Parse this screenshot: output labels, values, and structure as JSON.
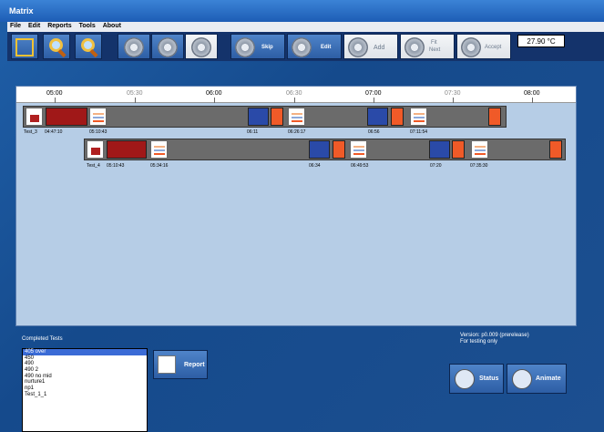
{
  "window": {
    "title": "Matrix"
  },
  "menu": [
    "File",
    "Edit",
    "Reports",
    "Tools",
    "About"
  ],
  "toolbar": {
    "skip_label": "Skip",
    "edit_label": "Edit",
    "add_label": "Add",
    "fit_label_1": "Fit",
    "fit_label_2": "Next",
    "accept_label": "Accept",
    "temperature": "27.90 °C",
    "icons": [
      "fit-view-icon",
      "zoom-out-icon",
      "zoom-in-icon",
      "gear-run-icon",
      "gear-stop-icon",
      "gear-play-icon"
    ]
  },
  "timeline": {
    "ticks": [
      {
        "label": "05:00",
        "major": true
      },
      {
        "label": "05:30",
        "major": false
      },
      {
        "label": "06:00",
        "major": true
      },
      {
        "label": "06:30",
        "major": false
      },
      {
        "label": "07:00",
        "major": true
      },
      {
        "label": "07:30",
        "major": false
      },
      {
        "label": "08:00",
        "major": true
      }
    ],
    "row1": {
      "name": "Test_3",
      "start": "04:47:10",
      "labels": [
        "05:10:43",
        "06:11",
        "06:26:17",
        "06:56",
        "07:11:54"
      ]
    },
    "row2": {
      "name": "Test_4",
      "start": "05:10:43",
      "labels": [
        "05:34:16",
        "06:34",
        "06:49:53",
        "07:20",
        "07:35:30"
      ]
    },
    "colors": {
      "background": "#b6cde6",
      "run": "#a01818",
      "blue": "#2a4aa8",
      "orange": "#f05a28",
      "idle": "#6b6b6b"
    }
  },
  "completed": {
    "label": "Completed Tests",
    "items": [
      "405 over",
      "450",
      "490",
      "490 2",
      "490 no mid",
      "nurture1",
      "np1",
      "Test_1_1"
    ],
    "selected_index": 0
  },
  "report_label": "Report",
  "version": {
    "line1": "Version: p0.009 (prerelease)",
    "line2": "For testing only"
  },
  "status_label": "Status",
  "animate_label": "Animate"
}
